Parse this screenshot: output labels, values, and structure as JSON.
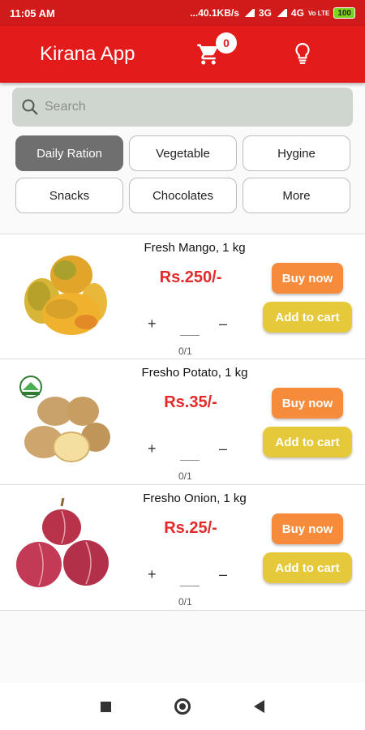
{
  "status": {
    "time": "11:05 AM",
    "speed": "...40.1KB/s",
    "net1": "3G",
    "net2": "4G",
    "volte": "Vo LTE",
    "battery": "100"
  },
  "app": {
    "title": "Kirana App",
    "cart_count": "0",
    "accent": "#e31b1b"
  },
  "search": {
    "placeholder": "Search",
    "value": ""
  },
  "categories": [
    {
      "label": "Daily Ration",
      "active": true
    },
    {
      "label": "Vegetable",
      "active": false
    },
    {
      "label": "Hygine",
      "active": false
    },
    {
      "label": "Snacks",
      "active": false
    },
    {
      "label": "Chocolates",
      "active": false
    },
    {
      "label": "More",
      "active": false
    }
  ],
  "products": [
    {
      "name": "Fresh Mango, 1 kg",
      "price": "Rs.250/-",
      "plus": "+",
      "minus": "–",
      "qty": "0/1",
      "buy": "Buy now",
      "add": "Add to cart",
      "image": "mango"
    },
    {
      "name": "Fresho Potato, 1 kg",
      "price": "Rs.35/-",
      "plus": "+",
      "minus": "–",
      "qty": "0/1",
      "buy": "Buy now",
      "add": "Add to cart",
      "image": "potato"
    },
    {
      "name": "Fresho Onion, 1 kg",
      "price": "Rs.25/-",
      "plus": "+",
      "minus": "–",
      "qty": "0/1",
      "buy": "Buy now",
      "add": "Add to cart",
      "image": "onion"
    }
  ],
  "icons": {
    "search": "search-icon",
    "cart": "cart-icon",
    "bulb": "lightbulb-icon",
    "nav_recent": "recents-icon",
    "nav_home": "home-icon",
    "nav_back": "back-icon"
  }
}
